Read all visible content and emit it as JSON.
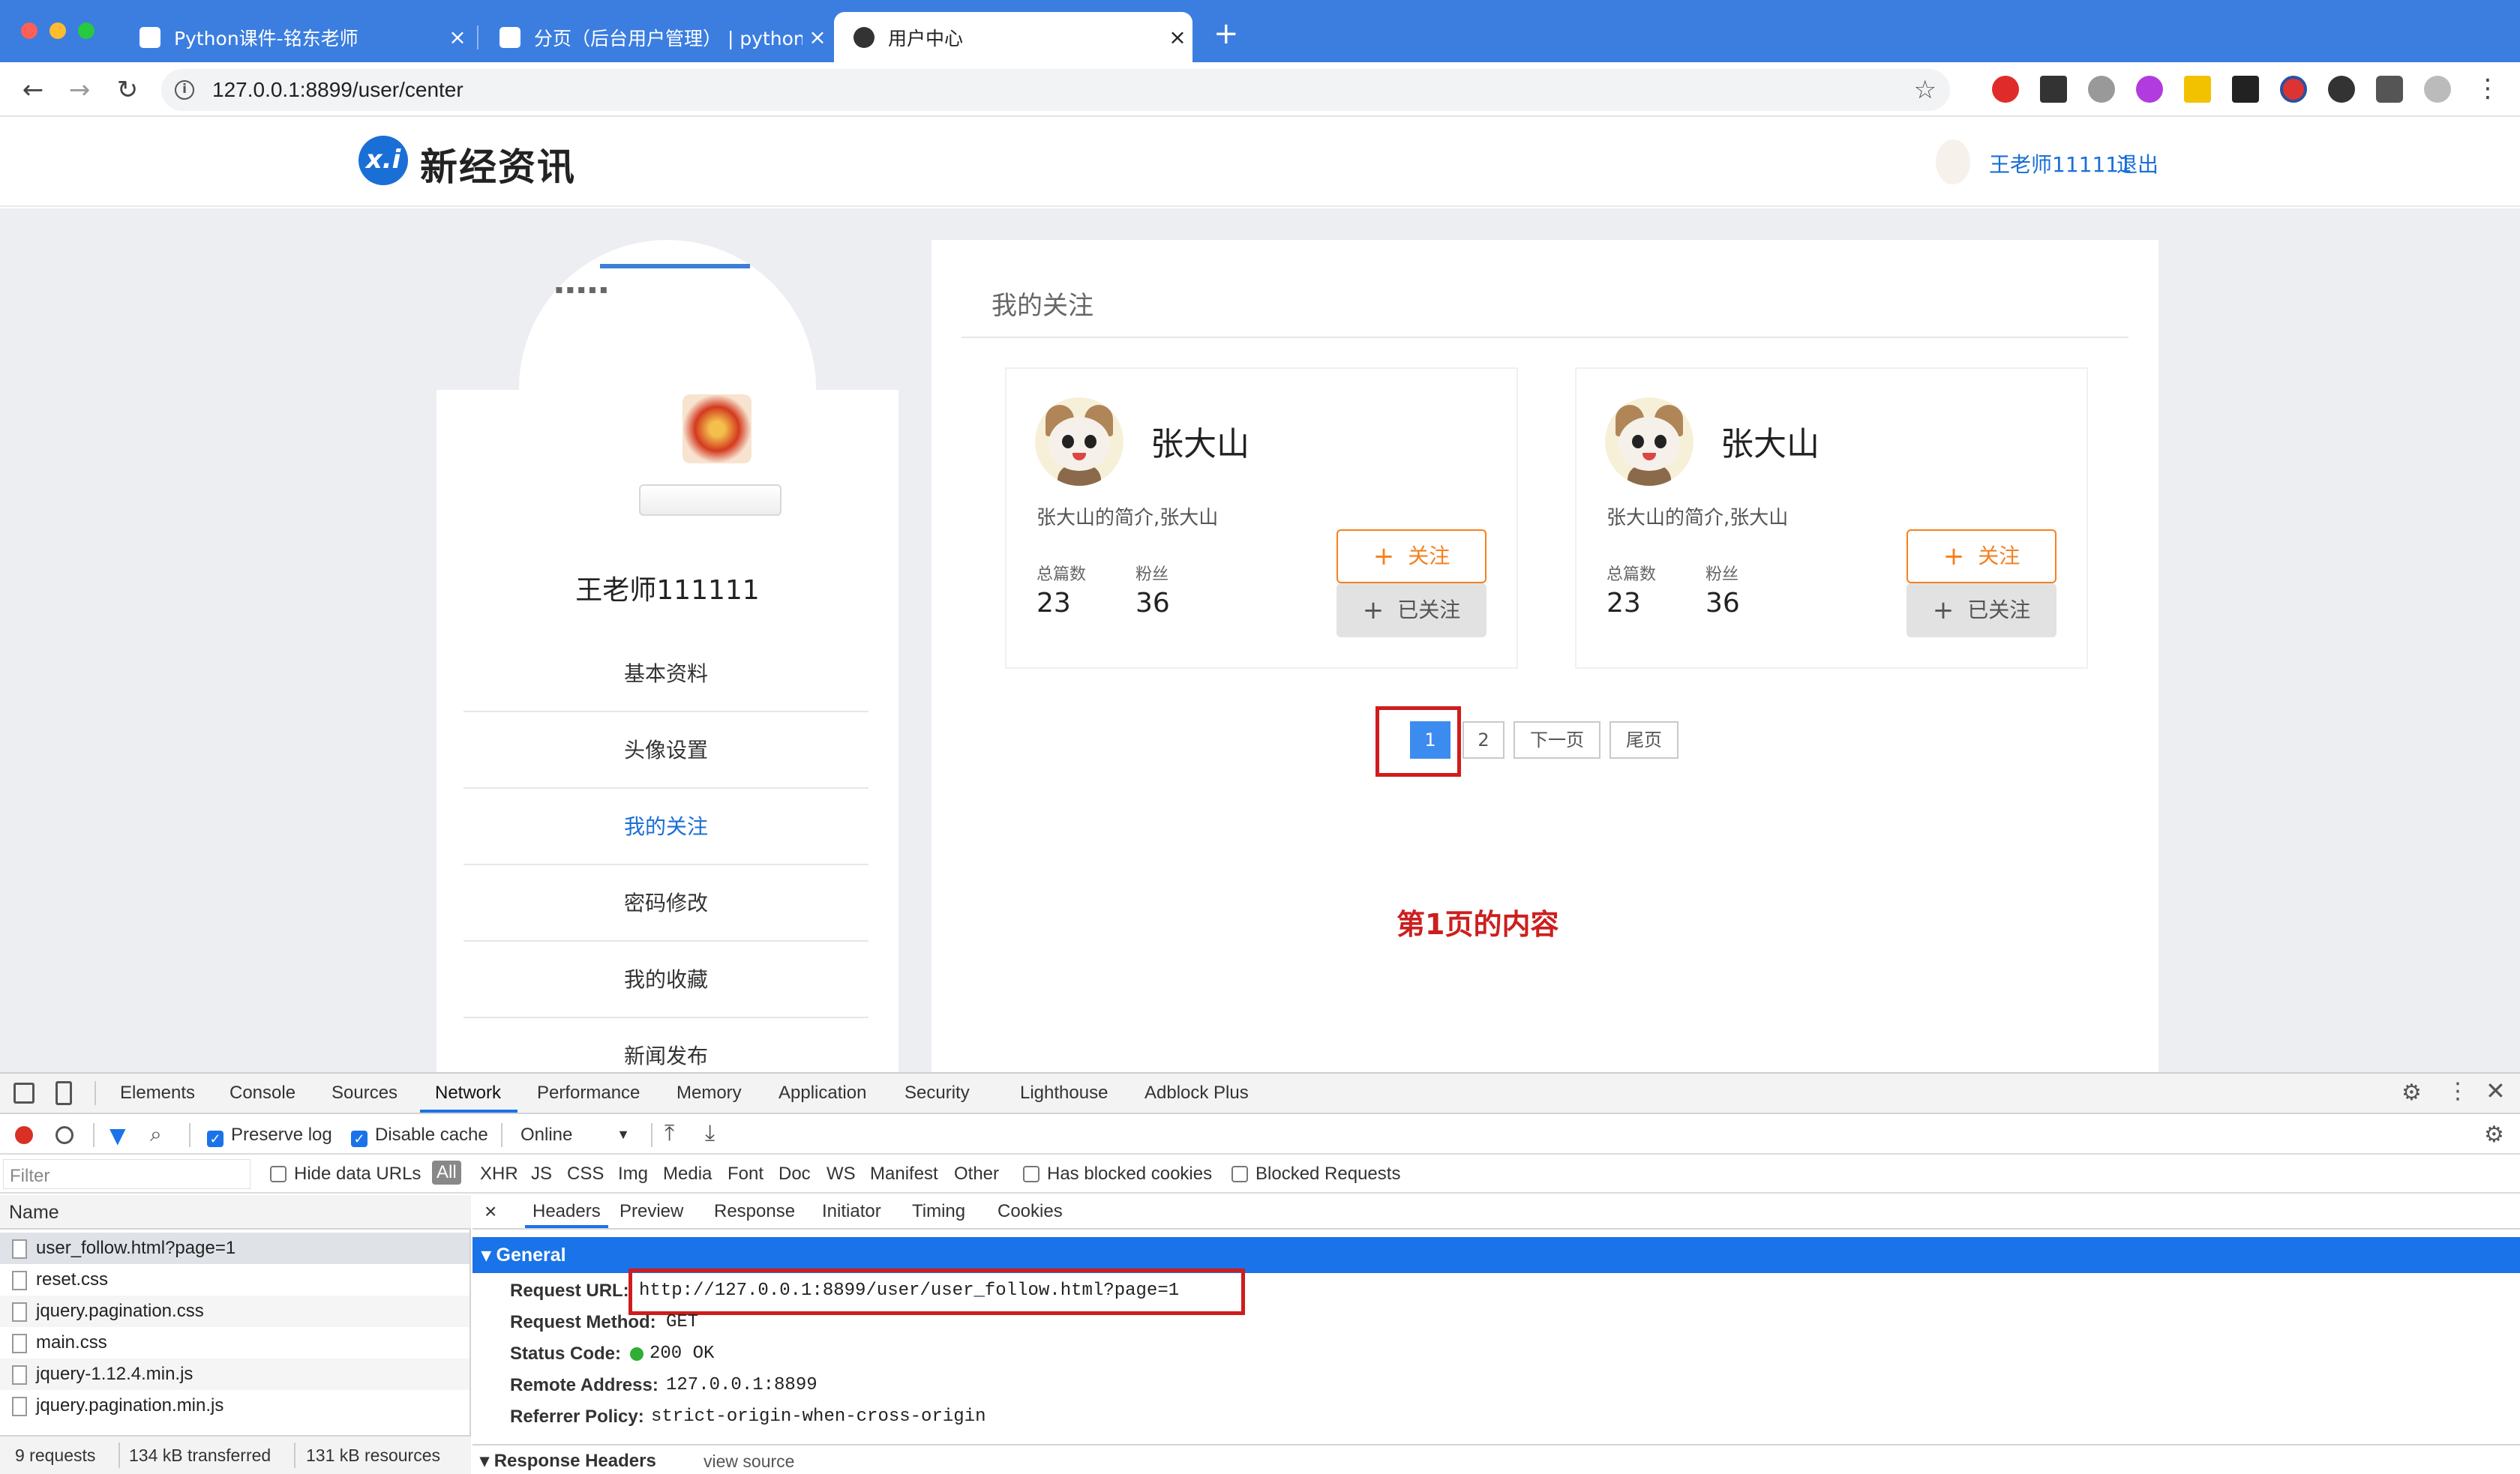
{
  "browser": {
    "tabs": [
      {
        "label": "Python课件-铭东老师"
      },
      {
        "label": "分页（后台用户管理） | python"
      },
      {
        "label": "用户中心"
      }
    ],
    "new_tab": "+",
    "close": "×",
    "url": "127.0.0.1:8899/user/center"
  },
  "site": {
    "logo_mark": "x.i",
    "logo_text": "新经资讯",
    "user_name": "王老师111111",
    "logout": "退出"
  },
  "sidebar": {
    "user_name": "王老师111111",
    "items": [
      {
        "label": "基本资料"
      },
      {
        "label": "头像设置"
      },
      {
        "label": "我的关注"
      },
      {
        "label": "密码修改"
      },
      {
        "label": "我的收藏"
      },
      {
        "label": "新闻发布"
      }
    ]
  },
  "main": {
    "section_title": "我的关注",
    "cards": [
      {
        "name": "张大山",
        "intro": "张大山的简介,张大山",
        "posts_label": "总篇数",
        "posts": "23",
        "fans_label": "粉丝",
        "fans": "36",
        "follow": "关注",
        "followed": "已关注"
      },
      {
        "name": "张大山",
        "intro": "张大山的简介,张大山",
        "posts_label": "总篇数",
        "posts": "23",
        "fans_label": "粉丝",
        "fans": "36",
        "follow": "关注",
        "followed": "已关注"
      }
    ],
    "pagination": {
      "page1": "1",
      "page2": "2",
      "next": "下一页",
      "last": "尾页"
    },
    "annotation": "第1页的内容"
  },
  "devtools": {
    "tabs": [
      "Elements",
      "Console",
      "Sources",
      "Network",
      "Performance",
      "Memory",
      "Application",
      "Security",
      "Lighthouse",
      "Adblock Plus"
    ],
    "preserve_log": "Preserve log",
    "disable_cache": "Disable cache",
    "throttle": "Online",
    "filter_placeholder": "Filter",
    "hide_data_urls": "Hide data URLs",
    "types": [
      "All",
      "XHR",
      "JS",
      "CSS",
      "Img",
      "Media",
      "Font",
      "Doc",
      "WS",
      "Manifest",
      "Other"
    ],
    "has_blocked": "Has blocked cookies",
    "blocked_requests": "Blocked Requests",
    "name_header": "Name",
    "requests": [
      "user_follow.html?page=1",
      "reset.css",
      "jquery.pagination.css",
      "main.css",
      "jquery-1.12.4.min.js",
      "jquery.pagination.min.js"
    ],
    "status": {
      "requests": "9 requests",
      "transferred": "134 kB transferred",
      "resources": "131 kB resources"
    },
    "detail_tabs": [
      "Headers",
      "Preview",
      "Response",
      "Initiator",
      "Timing",
      "Cookies"
    ],
    "general_title": "General",
    "general": {
      "url_label": "Request URL:",
      "url": "http://127.0.0.1:8899/user/user_follow.html?page=1",
      "method_label": "Request Method:",
      "method": "GET",
      "status_label": "Status Code:",
      "status": "200 OK",
      "remote_label": "Remote Address:",
      "remote": "127.0.0.1:8899",
      "referrer_label": "Referrer Policy:",
      "referrer": "strict-origin-when-cross-origin"
    },
    "response_headers": "Response Headers",
    "view_source": "view source"
  }
}
